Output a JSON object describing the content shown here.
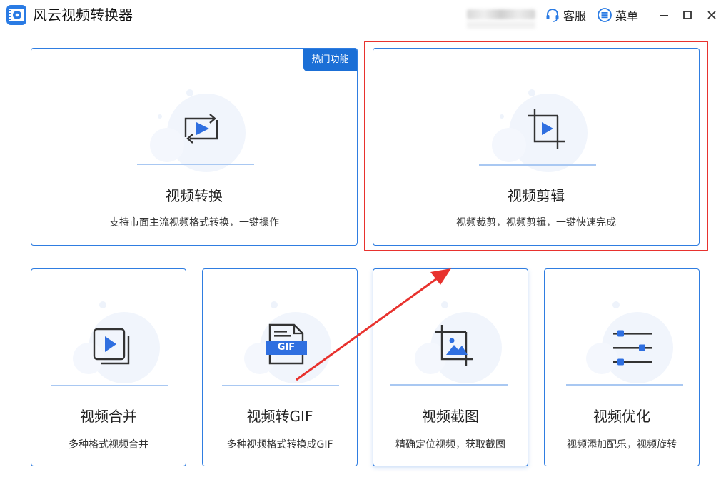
{
  "app": {
    "title": "风云视频转换器"
  },
  "header": {
    "service_label": "客服",
    "menu_label": "菜单"
  },
  "cards": [
    {
      "title": "视频转换",
      "desc": "支持市面主流视频格式转换，一键操作",
      "badge": "热门功能"
    },
    {
      "title": "视频剪辑",
      "desc": "视频裁剪，视频剪辑，一键快速完成"
    },
    {
      "title": "视频合并",
      "desc": "多种格式视频合并"
    },
    {
      "title": "视频转GIF",
      "desc": "多种视频格式转换成GIF",
      "icon_text": "GIF"
    },
    {
      "title": "视频截图",
      "desc": "精确定位视频，获取截图"
    },
    {
      "title": "视频优化",
      "desc": "视频添加配乐，视频旋转"
    }
  ],
  "colors": {
    "accent": "#2f7de1",
    "badge": "#1b6fd6",
    "annotation": "#e8322e",
    "icon_play": "#2f6fe0"
  },
  "icons": [
    "app-logo-icon",
    "headset-icon",
    "menu-list-icon",
    "minimize-icon",
    "maximize-icon",
    "close-icon",
    "convert-icon",
    "crop-play-icon",
    "merge-icon",
    "gif-file-icon",
    "screenshot-icon",
    "sliders-icon"
  ]
}
